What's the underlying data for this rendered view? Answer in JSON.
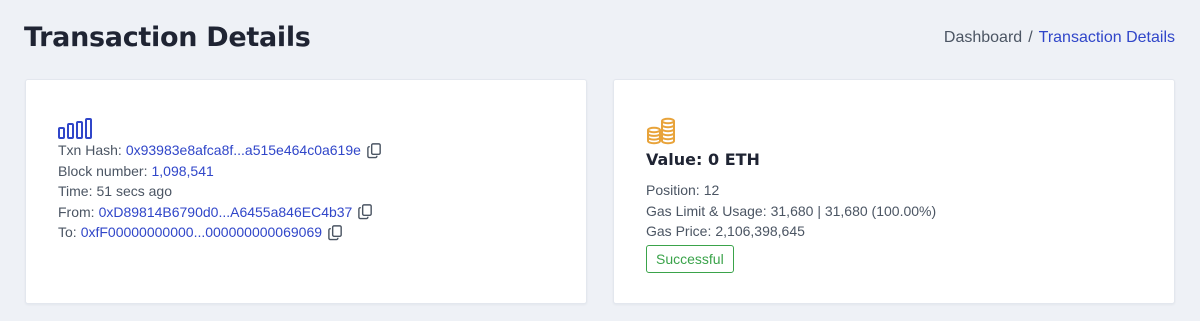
{
  "header": {
    "title": "Transaction Details",
    "breadcrumb": {
      "parent": "Dashboard",
      "separator": "/",
      "current": "Transaction Details"
    }
  },
  "tx_card": {
    "icon": "bar-chart-icon",
    "txn_hash_label": "Txn Hash:",
    "txn_hash": "0x93983e8afca8f...a515e464c0a619e",
    "block_label": "Block number:",
    "block_number": "1,098,541",
    "time_label": "Time:",
    "time": "51 secs ago",
    "from_label": "From:",
    "from": "0xD89814B6790d0...A6455a846EC4b37",
    "to_label": "To:",
    "to": "0xfF00000000000...000000000069069"
  },
  "value_card": {
    "icon": "coins-icon",
    "value_title": "Value: 0 ETH",
    "position_label": "Position:",
    "position": "12",
    "gas_label": "Gas Limit & Usage:",
    "gas": "31,680 | 31,680 (100.00%)",
    "gas_price_label": "Gas Price:",
    "gas_price": "2,106,398,645",
    "status": "Successful"
  },
  "colors": {
    "link": "#3046c9",
    "success": "#3aa34a",
    "coins": "#e8a33a"
  }
}
